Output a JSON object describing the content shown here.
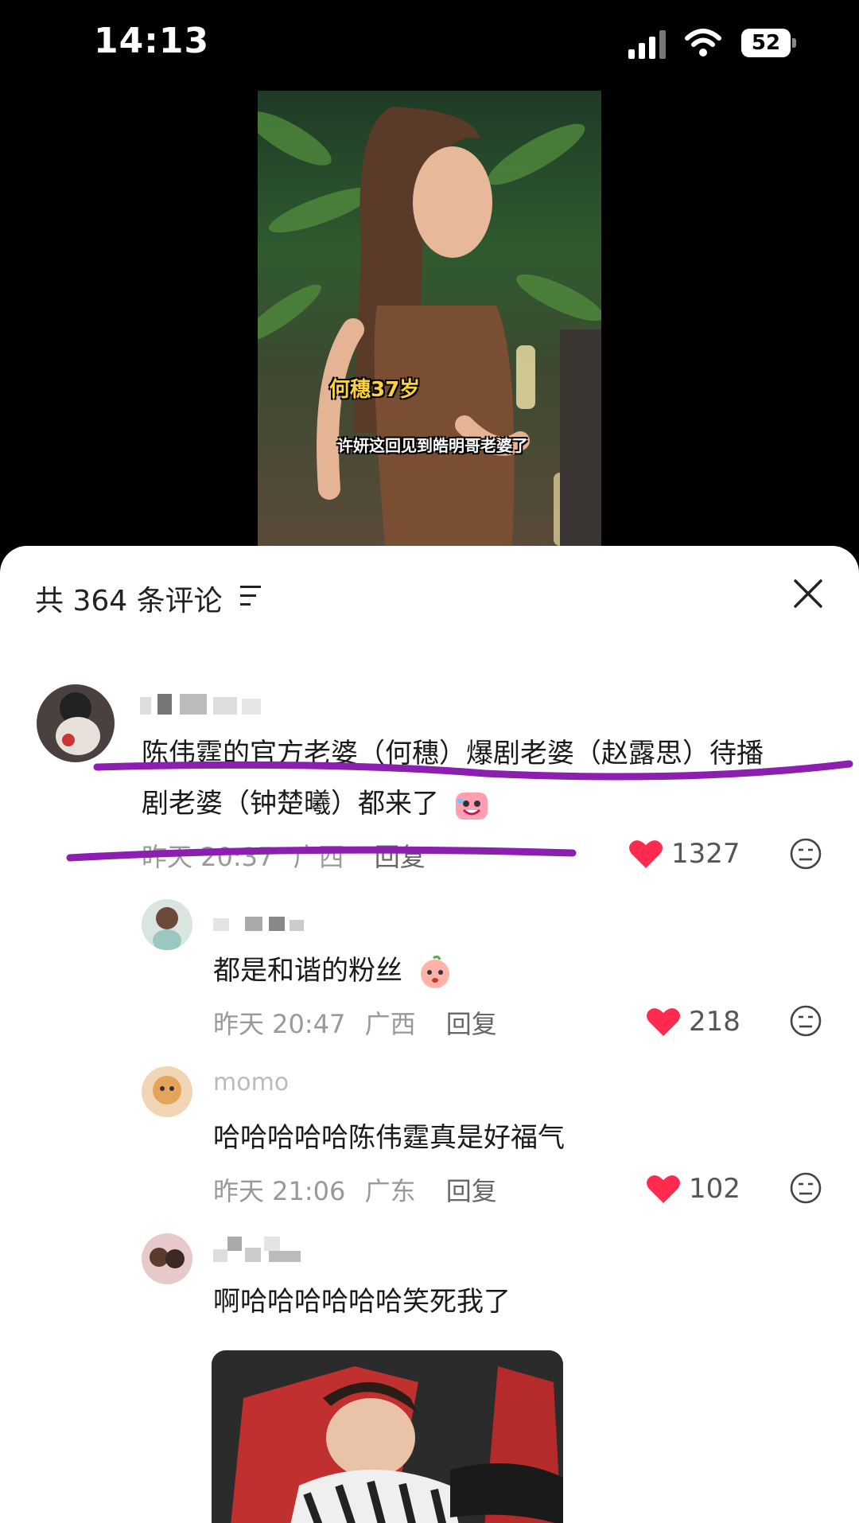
{
  "status_bar": {
    "time": "14:13",
    "battery": "52"
  },
  "video": {
    "caption_1": "何穗37岁",
    "caption_2": "许妍这回见到皓明哥老婆了"
  },
  "comments_header": {
    "title": "共 364 条评论"
  },
  "comments": [
    {
      "text_line1": "陈伟霆的官方老婆（何穗）爆剧老婆（赵露思）待播",
      "text_line2": "剧老婆（钟楚曦）都来了",
      "time": "昨天 20:37",
      "location": "广西",
      "reply_label": "回复",
      "likes": "1327"
    },
    {
      "text": "都是和谐的粉丝",
      "time": "昨天 20:47",
      "location": "广西",
      "reply_label": "回复",
      "likes": "218"
    },
    {
      "username": "momo",
      "text": "哈哈哈哈哈陈伟霆真是好福气",
      "time": "昨天 21:06",
      "location": "广东",
      "reply_label": "回复",
      "likes": "102"
    },
    {
      "text": "啊哈哈哈哈哈哈笑死我了"
    }
  ],
  "colors": {
    "like_red": "#ff2b4f",
    "annotation_purple": "#8a1fb0"
  }
}
